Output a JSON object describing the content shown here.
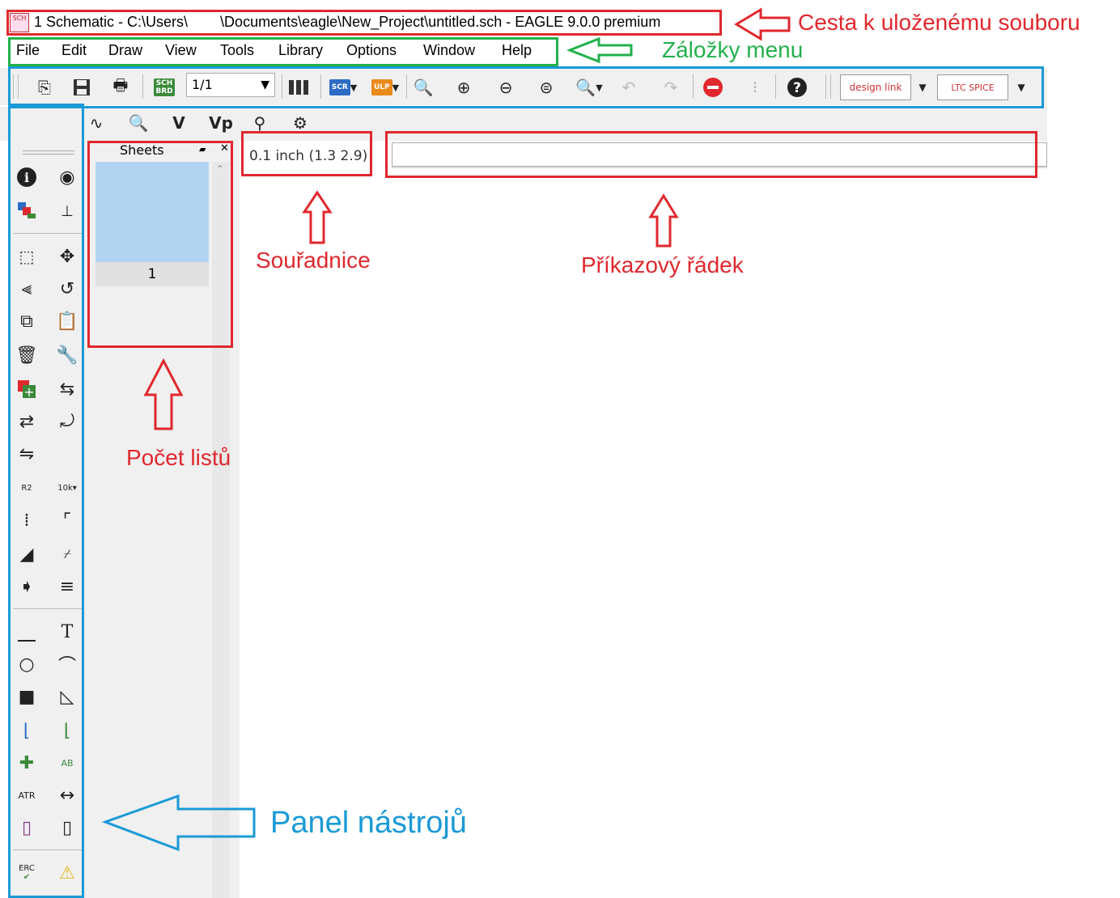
{
  "window": {
    "title": "1 Schematic - C:\\Users\\        \\Documents\\eagle\\New_Project\\untitled.sch - EAGLE 9.0.0 premium",
    "app_icon_label": "SCH"
  },
  "menu": {
    "items": [
      "File",
      "Edit",
      "Draw",
      "View",
      "Tools",
      "Library",
      "Options",
      "Window",
      "Help"
    ]
  },
  "toolbar": {
    "sheet_combo_value": "1/1",
    "scr_badge": "SCR",
    "ulp_badge": "ULP",
    "sch_brd_badge": "SCH BRD",
    "design_link_label": "design link",
    "ltspice_label": "LTC SPICE",
    "icons": [
      "open-icon",
      "save-icon",
      "print-icon",
      "sch-brd-switch-icon",
      "sheet-combo",
      "cam-icon",
      "script-icon",
      "ulp-icon",
      "zoom-fit-icon",
      "zoom-in-icon",
      "zoom-out-icon",
      "zoom-redraw-icon",
      "zoom-select-icon",
      "undo-icon",
      "redo-icon",
      "stop-icon",
      "go-icon",
      "help-icon",
      "design-link-icon",
      "ltspice-icon"
    ]
  },
  "toolbar2": {
    "icons": [
      "grid-icon",
      "simulate-icon",
      "probe-icon",
      "voltage-icon",
      "voltage-probe-icon",
      "net-probe-icon",
      "settings-icon"
    ],
    "voltage_label": "V",
    "voltage_probe_label": "Vp"
  },
  "sheets": {
    "header": "Sheets",
    "sheet_number": "1"
  },
  "coordinates": {
    "text": "0.1 inch (1.3 2.9)"
  },
  "command_line": {
    "value": ""
  },
  "tool_panel": {
    "icons": [
      "info-icon",
      "show-icon",
      "layer-settings-icon",
      "mark-icon",
      "group-icon",
      "move-icon",
      "mirror-icon",
      "rotate-icon",
      "copy-icon",
      "paste-icon",
      "delete-icon",
      "change-icon",
      "add-icon",
      "replace-icon",
      "invoke-icon",
      "gateswap-icon",
      "pinswap-icon",
      "name-icon",
      "value-icon",
      "smash-icon",
      "miter-icon",
      "split-icon",
      "optimize-icon",
      "wire-icon",
      "text-icon",
      "circle-icon",
      "arc-icon",
      "rect-icon",
      "polygon-icon",
      "bus-icon",
      "net-icon",
      "junction-icon",
      "label-icon",
      "attribute-icon",
      "dimension-icon",
      "frame-icon",
      "module-icon",
      "erc-icon",
      "errors-icon"
    ],
    "text_tool_label": "T",
    "erc_label": "ERC"
  },
  "annotations": {
    "file_path": "Cesta k uloženému souboru",
    "menu_tabs": "Záložky menu",
    "coordinates": "Souřadnice",
    "command_line": "Příkazový řádek",
    "sheet_count": "Počet listů",
    "tool_panel": "Panel nástrojů",
    "colors": {
      "red": "#e0282e",
      "green": "#22b14c",
      "blue": "#1a9ad6"
    }
  }
}
